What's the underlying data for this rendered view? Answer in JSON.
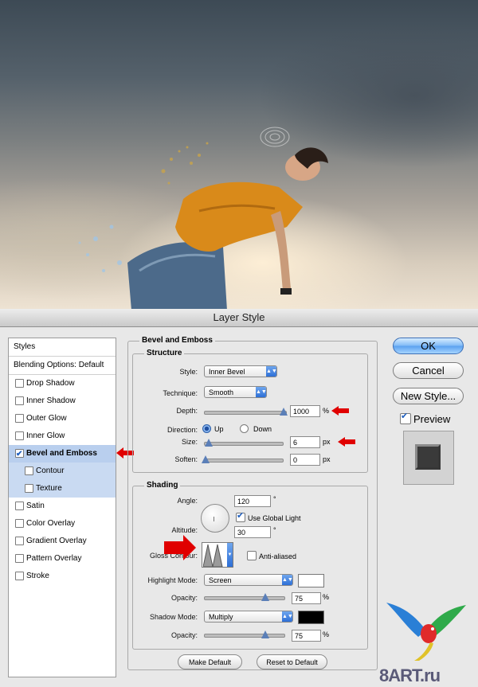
{
  "dialog": {
    "title": "Layer Style",
    "styles_header": "Styles",
    "blending_options": "Blending Options: Default",
    "style_items": [
      {
        "label": "Drop Shadow",
        "checked": false
      },
      {
        "label": "Inner Shadow",
        "checked": false
      },
      {
        "label": "Outer Glow",
        "checked": false
      },
      {
        "label": "Inner Glow",
        "checked": false
      },
      {
        "label": "Bevel and Emboss",
        "checked": true,
        "selected": true
      },
      {
        "label": "Contour",
        "checked": false,
        "sub": true
      },
      {
        "label": "Texture",
        "checked": false,
        "sub": true
      },
      {
        "label": "Satin",
        "checked": false
      },
      {
        "label": "Color Overlay",
        "checked": false
      },
      {
        "label": "Gradient Overlay",
        "checked": false
      },
      {
        "label": "Pattern Overlay",
        "checked": false
      },
      {
        "label": "Stroke",
        "checked": false
      }
    ]
  },
  "bevel": {
    "title": "Bevel and Emboss",
    "structure_title": "Structure",
    "style_label": "Style:",
    "style_value": "Inner Bevel",
    "technique_label": "Technique:",
    "technique_value": "Smooth",
    "depth_label": "Depth:",
    "depth_value": "1000",
    "depth_unit": "%",
    "direction_label": "Direction:",
    "dir_up": "Up",
    "dir_down": "Down",
    "size_label": "Size:",
    "size_value": "6",
    "size_unit": "px",
    "soften_label": "Soften:",
    "soften_value": "0",
    "soften_unit": "px"
  },
  "shading": {
    "title": "Shading",
    "angle_label": "Angle:",
    "angle_value": "120",
    "angle_unit": "°",
    "global_light": "Use Global Light",
    "altitude_label": "Altitude:",
    "altitude_value": "30",
    "altitude_unit": "°",
    "gloss_label": "Gloss Contour:",
    "anti_aliased": "Anti-aliased",
    "highlight_label": "Highlight Mode:",
    "highlight_value": "Screen",
    "highlight_color": "#ffffff",
    "opacity_label": "Opacity:",
    "highlight_opacity": "75",
    "opacity_unit": "%",
    "shadow_label": "Shadow Mode:",
    "shadow_value": "Multiply",
    "shadow_color": "#000000",
    "shadow_opacity": "75"
  },
  "buttons": {
    "make_default": "Make Default",
    "reset_default": "Reset to Default",
    "ok": "OK",
    "cancel": "Cancel",
    "new_style": "New Style...",
    "preview": "Preview"
  },
  "watermark": "8ART.ru",
  "colors": {
    "accent": "#5aa0ef",
    "selection": "#b9cfee",
    "annotation_arrow": "#e00000"
  }
}
